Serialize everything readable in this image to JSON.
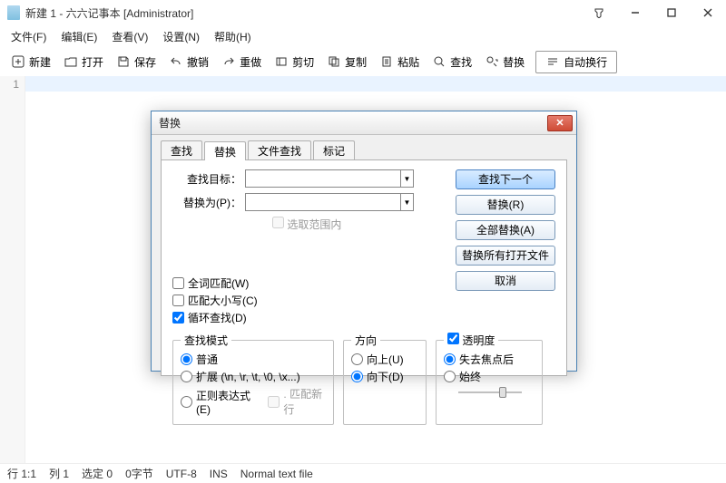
{
  "title": "新建 1 - 六六记事本 [Administrator]",
  "menu": {
    "file": "文件(F)",
    "edit": "编辑(E)",
    "view": "查看(V)",
    "settings": "设置(N)",
    "help": "帮助(H)"
  },
  "toolbar": {
    "new": "新建",
    "open": "打开",
    "save": "保存",
    "undo": "撤销",
    "redo": "重做",
    "cut": "剪切",
    "copy": "复制",
    "paste": "粘贴",
    "find": "查找",
    "replace": "替换",
    "wrap": "自动换行"
  },
  "gutter": {
    "line1": "1"
  },
  "status": {
    "row": "行 1:1",
    "col": "列 1",
    "sel": "选定 0",
    "bytes": "0字节",
    "encoding": "UTF-8",
    "mode": "INS",
    "filetype": "Normal text file"
  },
  "dialog": {
    "title": "替换",
    "tabs": {
      "find": "查找",
      "replace": "替换",
      "fileFind": "文件查找",
      "mark": "标记"
    },
    "labels": {
      "findTarget": "查找目标：",
      "replaceWith": "替换为(P)：",
      "inSelection": "选取范围内"
    },
    "buttons": {
      "findNext": "查找下一个",
      "replace": "替换(R)",
      "replaceAll": "全部替换(A)",
      "replaceAllOpen": "替换所有打开文件",
      "cancel": "取消"
    },
    "opts": {
      "wholeWord": "全词匹配(W)",
      "matchCase": "匹配大小写(C)",
      "wrapAround": "循环查找(D)"
    },
    "groups": {
      "mode": {
        "legend": "查找模式",
        "normal": "普通",
        "extended": "扩展 (\\n, \\r, \\t, \\0, \\x...)",
        "regex": "正则表达式(E)",
        "dotNewline": ". 匹配新行"
      },
      "direction": {
        "legend": "方向",
        "up": "向上(U)",
        "down": "向下(D)"
      },
      "transparency": {
        "legend": "透明度",
        "onLoseFocus": "失去焦点后",
        "always": "始终"
      }
    }
  }
}
